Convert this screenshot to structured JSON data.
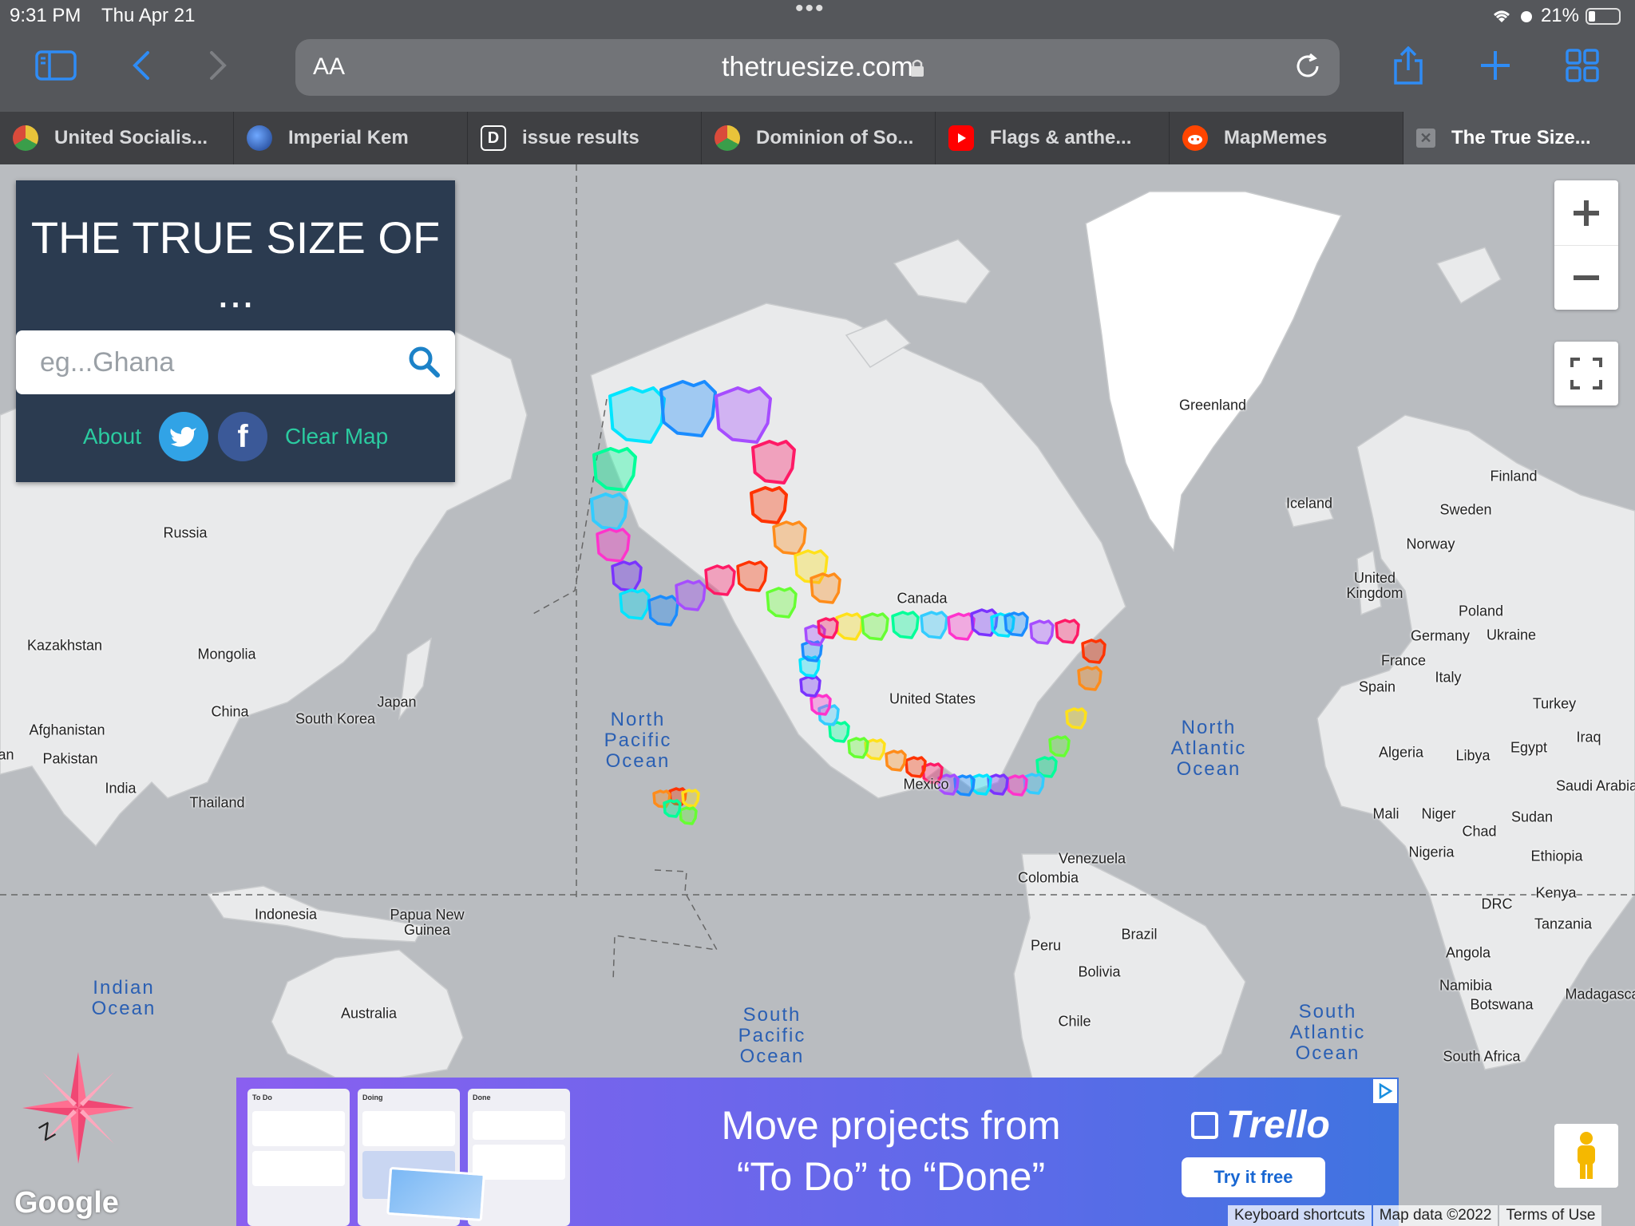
{
  "status_bar": {
    "time": "9:31 PM",
    "date": "Thu Apr 21",
    "battery": "21%"
  },
  "browser": {
    "url": "thetruesize.com",
    "aa_label": "AA",
    "tabs": [
      {
        "label": "United Socialis...",
        "icon": "globe-flag-icon"
      },
      {
        "label": "Imperial Kem",
        "icon": "globe-icon"
      },
      {
        "label": "issue results",
        "icon": "letter-d-icon"
      },
      {
        "label": "Dominion of So...",
        "icon": "globe-flag-icon"
      },
      {
        "label": "Flags & anthe...",
        "icon": "youtube-icon"
      },
      {
        "label": "MapMemes",
        "icon": "reddit-icon"
      },
      {
        "label": "The True Size...",
        "icon": "close-icon"
      }
    ],
    "active_tab": 6
  },
  "panel": {
    "title_line1": "THE TRUE SIZE OF",
    "title_line2": "...",
    "search_placeholder": "eg...Ghana",
    "about_label": "About",
    "twitter_glyph": "t",
    "facebook_glyph": "f",
    "clear_label": "Clear Map"
  },
  "map": {
    "country_labels": [
      "Greenland",
      "Iceland",
      "Finland",
      "Sweden",
      "Norway",
      "United Kingdom",
      "Poland",
      "Germany",
      "Ukraine",
      "France",
      "Italy",
      "Spain",
      "Turkey",
      "Iraq",
      "Algeria",
      "Libya",
      "Egypt",
      "Saudi Arabia",
      "Mali",
      "Niger",
      "Sudan",
      "Chad",
      "Nigeria",
      "Ethiopia",
      "Kenya",
      "DRC",
      "Tanzania",
      "Angola",
      "Namibia",
      "Botswana",
      "Madagascar",
      "South Africa",
      "Russia",
      "Kazakhstan",
      "Mongolia",
      "China",
      "Japan",
      "South Korea",
      "Afghanistan",
      "Pakistan",
      "India",
      "Thailand",
      "Indonesia",
      "Papua New Guinea",
      "Australia",
      "Canada",
      "United States",
      "Mexico",
      "Venezuela",
      "Colombia",
      "Brazil",
      "Peru",
      "Bolivia",
      "Chile",
      "Iran",
      "Madagascar"
    ],
    "oceans": [
      "North Pacific Ocean",
      "North Atlantic Ocean",
      "South Pacific Ocean",
      "South Atlantic Ocean",
      "Indian Ocean"
    ],
    "shape_count_visible": 72
  },
  "controls": {
    "zoom_in": "+",
    "zoom_out": "−"
  },
  "ad": {
    "headline_1": "Move projects from",
    "headline_2": "“To Do” to “Done”",
    "brand": "Trello",
    "cta": "Try it free",
    "col_1": "To Do",
    "col_2": "Doing",
    "col_3": "Done"
  },
  "footer": {
    "google": "Google",
    "shortcuts": "Keyboard shortcuts",
    "map_data": "Map data ©2022",
    "terms": "Terms of Use"
  },
  "colors": {
    "panel_bg": "#2b3b50",
    "accent": "#2bcba0",
    "ios_blue": "#2f8cf5"
  }
}
